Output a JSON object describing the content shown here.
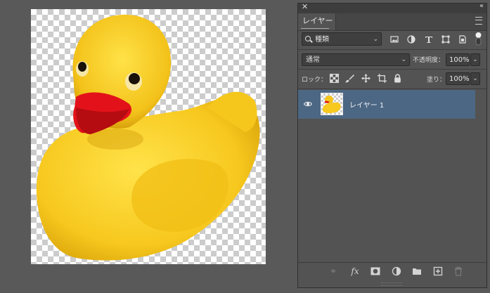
{
  "canvas": {
    "image_alt": "yellow rubber duck on transparent background"
  },
  "panel": {
    "close_glyph": "✕",
    "collapse_glyph": "‹‹",
    "tab_label": "レイヤー",
    "filter": {
      "label": "種類",
      "icon": "search-icon"
    },
    "filter_icons": [
      "image-filter-icon",
      "adjustment-filter-icon",
      "text-filter-icon",
      "shape-filter-icon",
      "smartobject-filter-icon"
    ],
    "blend_mode": "通常",
    "opacity_label": "不透明度：",
    "opacity_value": "100%",
    "lock_label": "ロック：",
    "fill_label": "塗り：",
    "fill_value": "100%",
    "layers": [
      {
        "name": "レイヤー 1",
        "visible": true,
        "selected": true
      }
    ],
    "bottom_icons": [
      "link-icon",
      "fx-icon",
      "mask-icon",
      "adjustment-icon",
      "folder-icon",
      "new-layer-icon",
      "trash-icon"
    ],
    "fx_label": "fx"
  },
  "colors": {
    "selection": "#4c6783",
    "panel_bg": "#535353",
    "workspace_bg": "#595959"
  }
}
